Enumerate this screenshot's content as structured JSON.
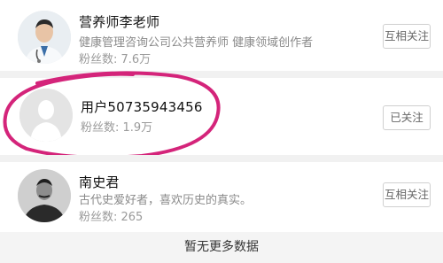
{
  "rows": [
    {
      "name": "营养师李老师",
      "description": "健康管理咨询公司公共营养师 健康领域创作者",
      "fans": "粉丝数: 7.6万",
      "button": "互相关注",
      "avatar_icon": "doctor-avatar"
    },
    {
      "name": "用户50735943456",
      "description": "",
      "fans": "粉丝数: 1.9万",
      "button": "已关注",
      "avatar_icon": "default-user-avatar"
    },
    {
      "name": "南史君",
      "description": "古代史爱好者，喜欢历史的真实。",
      "fans": "粉丝数: 265",
      "button": "互相关注",
      "avatar_icon": "portrait-avatar"
    }
  ],
  "footer": {
    "text": "暂无更多数据"
  },
  "colors": {
    "highlight_circle": "#d4247a"
  }
}
